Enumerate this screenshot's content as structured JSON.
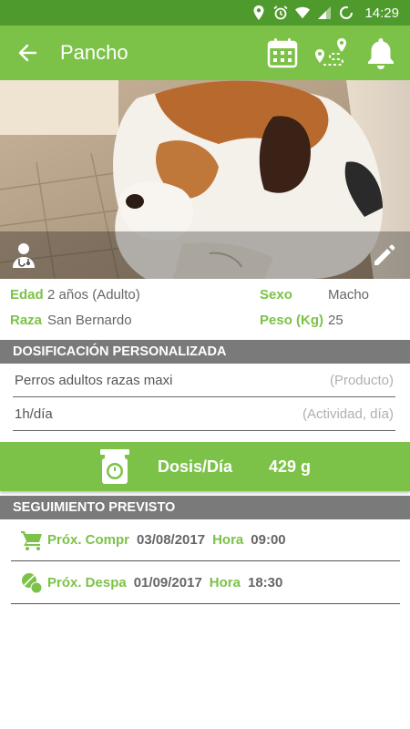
{
  "status_bar": {
    "time": "14:29",
    "icons": [
      "location-icon",
      "alarm-icon",
      "wifi-icon",
      "signal-icon",
      "battery-icon"
    ]
  },
  "app_bar": {
    "title": "Pancho",
    "actions": [
      "calendar-icon",
      "route-icon",
      "bell-icon"
    ]
  },
  "hero": {
    "image_subject": "Perro San Bernardo",
    "actions": [
      "vet-icon",
      "pencil-icon"
    ]
  },
  "pet_info": {
    "age_label": "Edad",
    "age_value": "2 años (Adulto)",
    "sex_label": "Sexo",
    "sex_value": "Macho",
    "breed_label": "Raza",
    "breed_value": "San Bernardo",
    "weight_label": "Peso (Kg)",
    "weight_value": "25"
  },
  "dosage": {
    "header": "DOSIFICACIÓN PERSONALIZADA",
    "product_value": "Perros adultos razas maxi",
    "product_hint": "(Producto)",
    "activity_value": "1h/día",
    "activity_hint": "(Actividad, día)",
    "dose_label": "Dosis/Día",
    "dose_value": "429 g"
  },
  "tracking": {
    "header": "SEGUIMIENTO PREVISTO",
    "items": [
      {
        "label": "Próx. Compr",
        "date": "03/08/2017",
        "time_label": "Hora",
        "time": "09:00",
        "icon": "cart-icon"
      },
      {
        "label": "Próx. Despa",
        "date": "01/09/2017",
        "time_label": "Hora",
        "time": "18:30",
        "icon": "pills-icon"
      }
    ]
  },
  "colors": {
    "accent": "#7cc248",
    "status_bar": "#4f9a2c",
    "section_header": "#7a7a7a"
  }
}
